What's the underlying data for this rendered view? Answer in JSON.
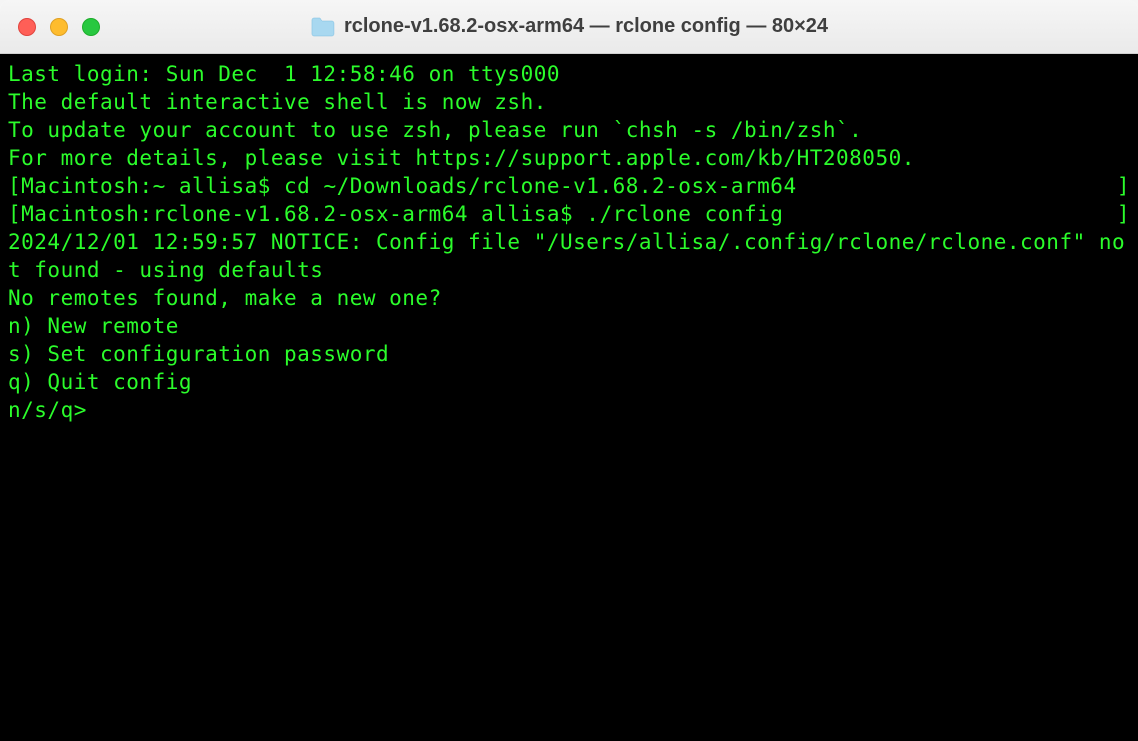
{
  "window": {
    "title": "rclone-v1.68.2-osx-arm64 — rclone config — 80×24"
  },
  "terminal": {
    "last_login": "Last login: Sun Dec  1 12:58:46 on ttys000",
    "blank1": "",
    "zsh_msg1": "The default interactive shell is now zsh.",
    "zsh_msg2": "To update your account to use zsh, please run `chsh -s /bin/zsh`.",
    "zsh_msg3": "For more details, please visit https://support.apple.com/kb/HT208050.",
    "prompt1_open": "[",
    "prompt1_text": "Macintosh:~ allisa$ cd ~/Downloads/rclone-v1.68.2-osx-arm64",
    "prompt1_close": "]",
    "prompt2_open": "[",
    "prompt2_text": "Macintosh:rclone-v1.68.2-osx-arm64 allisa$ ./rclone config",
    "prompt2_close": "]",
    "notice": "2024/12/01 12:59:57 NOTICE: Config file \"/Users/allisa/.config/rclone/rclone.conf\" not found - using defaults",
    "no_remotes": "No remotes found, make a new one?",
    "option_n": "n) New remote",
    "option_s": "s) Set configuration password",
    "option_q": "q) Quit config",
    "input_prompt": "n/s/q> "
  }
}
